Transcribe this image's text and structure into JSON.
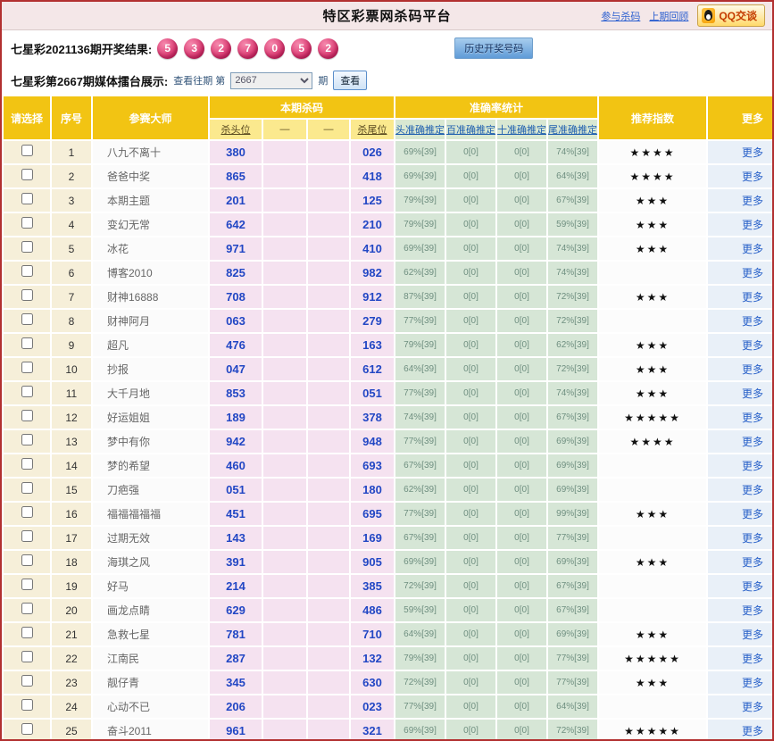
{
  "page": {
    "title": "特区彩票网杀码平台",
    "nav_links": [
      {
        "label": "参与杀码"
      },
      {
        "label": "上期回顾"
      }
    ],
    "qq_button": "QQ交谈",
    "result_label": "七星彩2021136期开奖结果:",
    "result_numbers": [
      "5",
      "3",
      "2",
      "7",
      "0",
      "5",
      "2"
    ],
    "history_button": "历史开奖号码",
    "media_label": "七星彩第2667期媒体擂台展示:",
    "view_past_label": "查看往期 第",
    "period_value": "2667",
    "period_suffix": "期",
    "view_button": "查看"
  },
  "colors": {
    "header_gold": "#f2c413",
    "subheader_yellow": "#fbe98e",
    "subheader_green": "#d9e8d2",
    "ball_pink": "#e0457b",
    "kill_cell_pink": "#f5e2f0",
    "accuracy_cell_green": "#d6e6d6",
    "link_blue": "#2a62c9",
    "page_border_red": "#b23030"
  },
  "table": {
    "headers": {
      "select": "请选择",
      "index": "序号",
      "master": "参赛大师",
      "kill_group": "本期杀码",
      "accuracy_group": "准确率统计",
      "recommend": "推荐指数",
      "more": "更多",
      "kill_cols": [
        "杀头位",
        "—",
        "—",
        "杀尾位"
      ],
      "accuracy_cols": [
        "头准确推定",
        "百准确推定",
        "十准确推定",
        "尾准确推定"
      ]
    },
    "more_label": "更多",
    "rows": [
      {
        "no": "1",
        "master": "八九不离十",
        "kill_head": "380",
        "kill_tail": "026",
        "acc_head": "69%[39]",
        "acc_hundred": "0[0]",
        "acc_ten": "0[0]",
        "acc_tail": "74%[39]",
        "stars": "★★★★"
      },
      {
        "no": "2",
        "master": "爸爸中奖",
        "kill_head": "865",
        "kill_tail": "418",
        "acc_head": "69%[39]",
        "acc_hundred": "0[0]",
        "acc_ten": "0[0]",
        "acc_tail": "64%[39]",
        "stars": "★★★★"
      },
      {
        "no": "3",
        "master": "本期主题",
        "kill_head": "201",
        "kill_tail": "125",
        "acc_head": "79%[39]",
        "acc_hundred": "0[0]",
        "acc_ten": "0[0]",
        "acc_tail": "67%[39]",
        "stars": "★★★"
      },
      {
        "no": "4",
        "master": "变幻无常",
        "kill_head": "642",
        "kill_tail": "210",
        "acc_head": "79%[39]",
        "acc_hundred": "0[0]",
        "acc_ten": "0[0]",
        "acc_tail": "59%[39]",
        "stars": "★★★"
      },
      {
        "no": "5",
        "master": "冰花",
        "kill_head": "971",
        "kill_tail": "410",
        "acc_head": "69%[39]",
        "acc_hundred": "0[0]",
        "acc_ten": "0[0]",
        "acc_tail": "74%[39]",
        "stars": "★★★"
      },
      {
        "no": "6",
        "master": "博客2010",
        "kill_head": "825",
        "kill_tail": "982",
        "acc_head": "62%[39]",
        "acc_hundred": "0[0]",
        "acc_ten": "0[0]",
        "acc_tail": "74%[39]",
        "stars": ""
      },
      {
        "no": "7",
        "master": "财神16888",
        "kill_head": "708",
        "kill_tail": "912",
        "acc_head": "87%[39]",
        "acc_hundred": "0[0]",
        "acc_ten": "0[0]",
        "acc_tail": "72%[39]",
        "stars": "★★★"
      },
      {
        "no": "8",
        "master": "财神阿月",
        "kill_head": "063",
        "kill_tail": "279",
        "acc_head": "77%[39]",
        "acc_hundred": "0[0]",
        "acc_ten": "0[0]",
        "acc_tail": "72%[39]",
        "stars": ""
      },
      {
        "no": "9",
        "master": "超凡",
        "kill_head": "476",
        "kill_tail": "163",
        "acc_head": "79%[39]",
        "acc_hundred": "0[0]",
        "acc_ten": "0[0]",
        "acc_tail": "62%[39]",
        "stars": "★★★"
      },
      {
        "no": "10",
        "master": "抄报",
        "kill_head": "047",
        "kill_tail": "612",
        "acc_head": "64%[39]",
        "acc_hundred": "0[0]",
        "acc_ten": "0[0]",
        "acc_tail": "72%[39]",
        "stars": "★★★"
      },
      {
        "no": "11",
        "master": "大千月地",
        "kill_head": "853",
        "kill_tail": "051",
        "acc_head": "77%[39]",
        "acc_hundred": "0[0]",
        "acc_ten": "0[0]",
        "acc_tail": "74%[39]",
        "stars": "★★★"
      },
      {
        "no": "12",
        "master": "好运姐姐",
        "kill_head": "189",
        "kill_tail": "378",
        "acc_head": "74%[39]",
        "acc_hundred": "0[0]",
        "acc_ten": "0[0]",
        "acc_tail": "67%[39]",
        "stars": "★★★★★"
      },
      {
        "no": "13",
        "master": "梦中有你",
        "kill_head": "942",
        "kill_tail": "948",
        "acc_head": "77%[39]",
        "acc_hundred": "0[0]",
        "acc_ten": "0[0]",
        "acc_tail": "69%[39]",
        "stars": "★★★★"
      },
      {
        "no": "14",
        "master": "梦的希望",
        "kill_head": "460",
        "kill_tail": "693",
        "acc_head": "67%[39]",
        "acc_hundred": "0[0]",
        "acc_ten": "0[0]",
        "acc_tail": "69%[39]",
        "stars": ""
      },
      {
        "no": "15",
        "master": "刀疤强",
        "kill_head": "051",
        "kill_tail": "180",
        "acc_head": "62%[39]",
        "acc_hundred": "0[0]",
        "acc_ten": "0[0]",
        "acc_tail": "69%[39]",
        "stars": ""
      },
      {
        "no": "16",
        "master": "福福福福福",
        "kill_head": "451",
        "kill_tail": "695",
        "acc_head": "77%[39]",
        "acc_hundred": "0[0]",
        "acc_ten": "0[0]",
        "acc_tail": "99%[39]",
        "stars": "★★★"
      },
      {
        "no": "17",
        "master": "过期无效",
        "kill_head": "143",
        "kill_tail": "169",
        "acc_head": "67%[39]",
        "acc_hundred": "0[0]",
        "acc_ten": "0[0]",
        "acc_tail": "77%[39]",
        "stars": ""
      },
      {
        "no": "18",
        "master": "海琪之风",
        "kill_head": "391",
        "kill_tail": "905",
        "acc_head": "69%[39]",
        "acc_hundred": "0[0]",
        "acc_ten": "0[0]",
        "acc_tail": "69%[39]",
        "stars": "★★★"
      },
      {
        "no": "19",
        "master": "好马",
        "kill_head": "214",
        "kill_tail": "385",
        "acc_head": "72%[39]",
        "acc_hundred": "0[0]",
        "acc_ten": "0[0]",
        "acc_tail": "67%[39]",
        "stars": ""
      },
      {
        "no": "20",
        "master": "画龙点睛",
        "kill_head": "629",
        "kill_tail": "486",
        "acc_head": "59%[39]",
        "acc_hundred": "0[0]",
        "acc_ten": "0[0]",
        "acc_tail": "67%[39]",
        "stars": ""
      },
      {
        "no": "21",
        "master": "急救七星",
        "kill_head": "781",
        "kill_tail": "710",
        "acc_head": "64%[39]",
        "acc_hundred": "0[0]",
        "acc_ten": "0[0]",
        "acc_tail": "69%[39]",
        "stars": "★★★"
      },
      {
        "no": "22",
        "master": "江南民",
        "kill_head": "287",
        "kill_tail": "132",
        "acc_head": "79%[39]",
        "acc_hundred": "0[0]",
        "acc_ten": "0[0]",
        "acc_tail": "77%[39]",
        "stars": "★★★★★"
      },
      {
        "no": "23",
        "master": "靓仔青",
        "kill_head": "345",
        "kill_tail": "630",
        "acc_head": "72%[39]",
        "acc_hundred": "0[0]",
        "acc_ten": "0[0]",
        "acc_tail": "77%[39]",
        "stars": "★★★"
      },
      {
        "no": "24",
        "master": "心动不已",
        "kill_head": "206",
        "kill_tail": "023",
        "acc_head": "77%[39]",
        "acc_hundred": "0[0]",
        "acc_ten": "0[0]",
        "acc_tail": "64%[39]",
        "stars": ""
      },
      {
        "no": "25",
        "master": "奋斗2011",
        "kill_head": "961",
        "kill_tail": "321",
        "acc_head": "69%[39]",
        "acc_hundred": "0[0]",
        "acc_ten": "0[0]",
        "acc_tail": "72%[39]",
        "stars": "★★★★★"
      }
    ]
  }
}
